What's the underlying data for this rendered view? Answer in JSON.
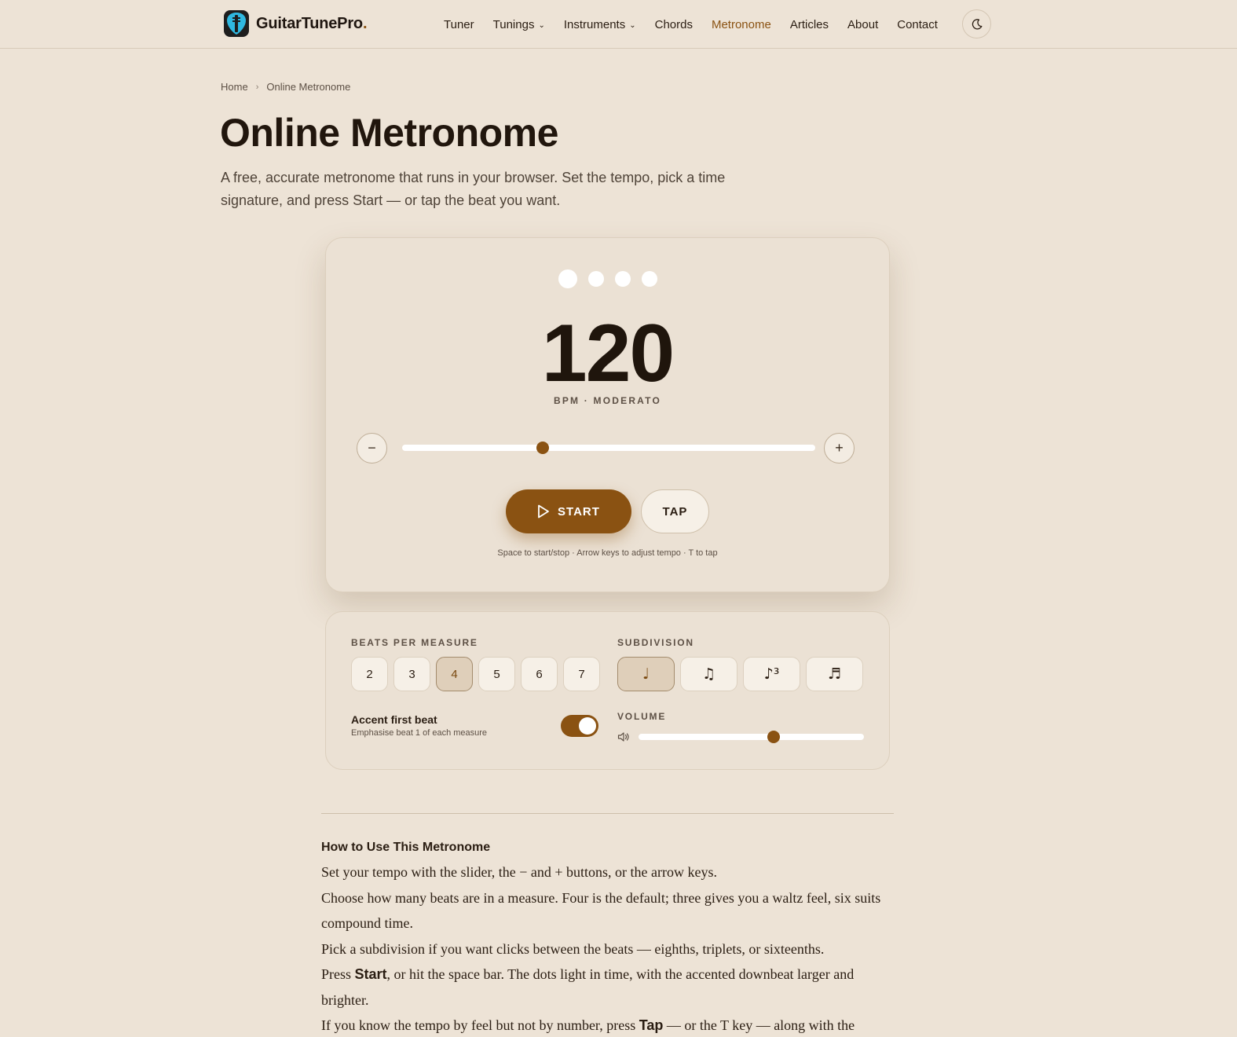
{
  "header": {
    "brand": "GuitarTunePro",
    "brand_dot": ".",
    "nav": [
      {
        "label": "Tuner",
        "active": false,
        "dropdown": false
      },
      {
        "label": "Tunings",
        "active": false,
        "dropdown": true
      },
      {
        "label": "Instruments",
        "active": false,
        "dropdown": true
      },
      {
        "label": "Chords",
        "active": false,
        "dropdown": false
      },
      {
        "label": "Metronome",
        "active": true,
        "dropdown": false
      },
      {
        "label": "Articles",
        "active": false,
        "dropdown": false
      },
      {
        "label": "About",
        "active": false,
        "dropdown": false
      },
      {
        "label": "Contact",
        "active": false,
        "dropdown": false
      }
    ],
    "theme_icon": "moon-icon"
  },
  "breadcrumb": {
    "home": "Home",
    "current": "Online Metronome"
  },
  "page": {
    "title": "Online Metronome",
    "lead": "A free, accurate metronome that runs in your browser. Set the tempo, pick a time signature, and press Start — or tap the beat you want."
  },
  "metronome": {
    "beats_shown": 4,
    "bpm": "120",
    "bpm_label": "BPM · MODERATO",
    "decrement": "−",
    "increment": "+",
    "tempo_slider_fraction": 0.34,
    "start_label": "START",
    "tap_label": "TAP",
    "hint": "Space to start/stop · Arrow keys to adjust tempo · T to tap"
  },
  "settings": {
    "beats_label": "BEATS PER MEASURE",
    "beats_options": [
      "2",
      "3",
      "4",
      "5",
      "6",
      "7"
    ],
    "beats_selected": "4",
    "subdivision_label": "SUBDIVISION",
    "subdivision_options": [
      {
        "glyph": "♩",
        "icon": "quarter-note-icon",
        "selected": true
      },
      {
        "glyph": "♫",
        "icon": "eighth-notes-icon",
        "selected": false
      },
      {
        "glyph": "♪³",
        "icon": "triplet-icon",
        "selected": false
      },
      {
        "glyph": "♬",
        "icon": "sixteenth-notes-icon",
        "selected": false
      }
    ],
    "accent_title": "Accent first beat",
    "accent_desc": "Emphasise beat 1 of each measure",
    "accent_on": true,
    "volume_label": "VOLUME",
    "volume_fraction": 0.6
  },
  "colors": {
    "accent": "#8a5212",
    "background": "#ede3d6"
  },
  "article": {
    "title": "How to Use This Metronome",
    "lines": [
      {
        "pre": "Set your tempo with the slider, the − and + buttons, or the arrow keys.",
        "bold": "",
        "post": ""
      },
      {
        "pre": "Choose how many beats are in a measure. Four is the default; three gives you a waltz feel, six suits compound time.",
        "bold": "",
        "post": ""
      },
      {
        "pre": "Pick a subdivision if you want clicks between the beats — eighths, triplets, or sixteenths.",
        "bold": "",
        "post": ""
      },
      {
        "pre": "Press ",
        "bold": "Start",
        "post": ", or hit the space bar. The dots light in time, with the accented downbeat larger and brighter."
      },
      {
        "pre": "If you know the tempo by feel but not by number, press ",
        "bold": "Tap",
        "post": " — or the T key — along with the"
      }
    ]
  }
}
